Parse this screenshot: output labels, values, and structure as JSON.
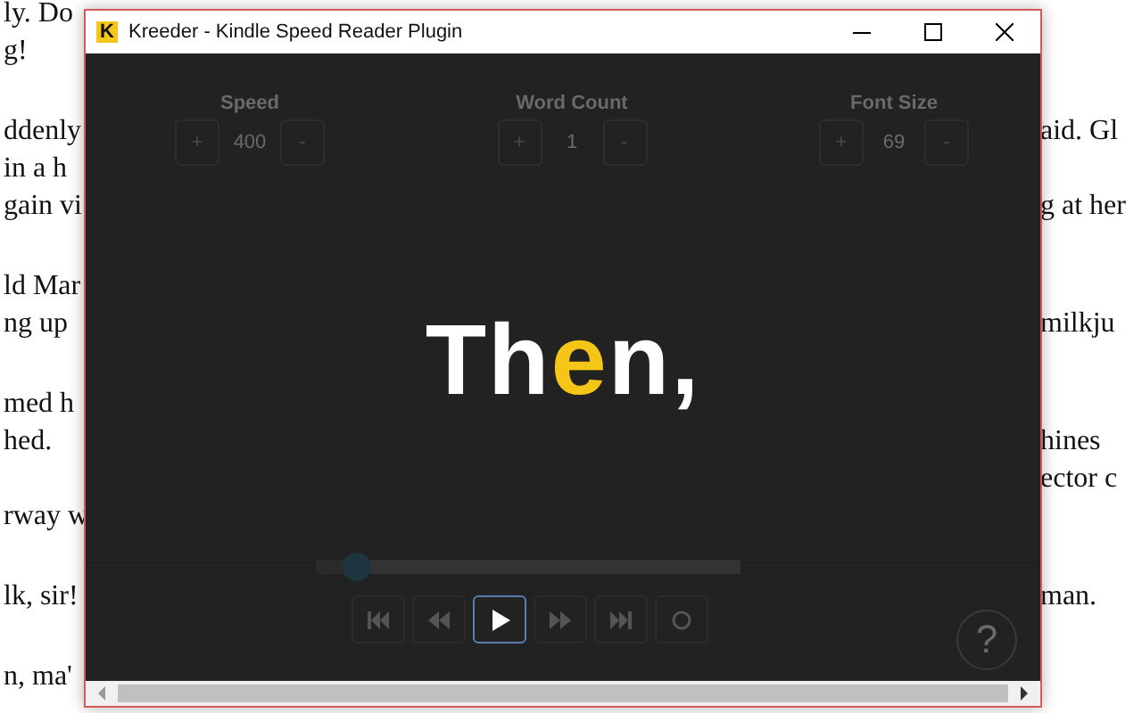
{
  "document": {
    "paragraphs": [
      {
        "lines": [
          {
            "left": "ly. Do"
          },
          {
            "left": "g!"
          }
        ]
      },
      {
        "lines": [
          {
            "left": "ddenly",
            "right": "aid. Gl"
          },
          {
            "left": "in a h"
          },
          {
            "left": "gain vi",
            "right": "g at her"
          }
        ]
      },
      {
        "lines": [
          {
            "left": "ld Mar"
          },
          {
            "left": "ng up",
            "right": "milkju"
          }
        ]
      },
      {
        "lines": [
          {
            "left": "med h"
          },
          {
            "left": "hed.",
            "right": "hines"
          },
          {
            "right": "ector c"
          },
          {
            "left": "rway w"
          }
        ]
      },
      {
        "lines": [
          {
            "left": "lk, sir!",
            "right": "man."
          }
        ]
      },
      {
        "lines": [
          {
            "left": "n, ma'"
          }
        ]
      }
    ]
  },
  "window": {
    "title": "Kreeder - Kindle Speed Reader Plugin",
    "logo_letter": "K"
  },
  "settings": [
    {
      "label": "Speed",
      "plus": "+",
      "value": "400",
      "minus": "-"
    },
    {
      "label": "Word Count",
      "plus": "+",
      "value": "1",
      "minus": "-"
    },
    {
      "label": "Font Size",
      "plus": "+",
      "value": "69",
      "minus": "-"
    }
  ],
  "word": {
    "before": "Th",
    "focus": "e",
    "after": "n,"
  },
  "progress": {
    "level": 0.1
  },
  "controls": [
    {
      "kind": "skip-back",
      "focused": false
    },
    {
      "kind": "rewind",
      "focused": false
    },
    {
      "kind": "play",
      "focused": true
    },
    {
      "kind": "forward",
      "focused": false
    },
    {
      "kind": "skip-forward",
      "focused": false
    },
    {
      "kind": "stop",
      "focused": false
    }
  ],
  "help": {
    "label": "?"
  }
}
